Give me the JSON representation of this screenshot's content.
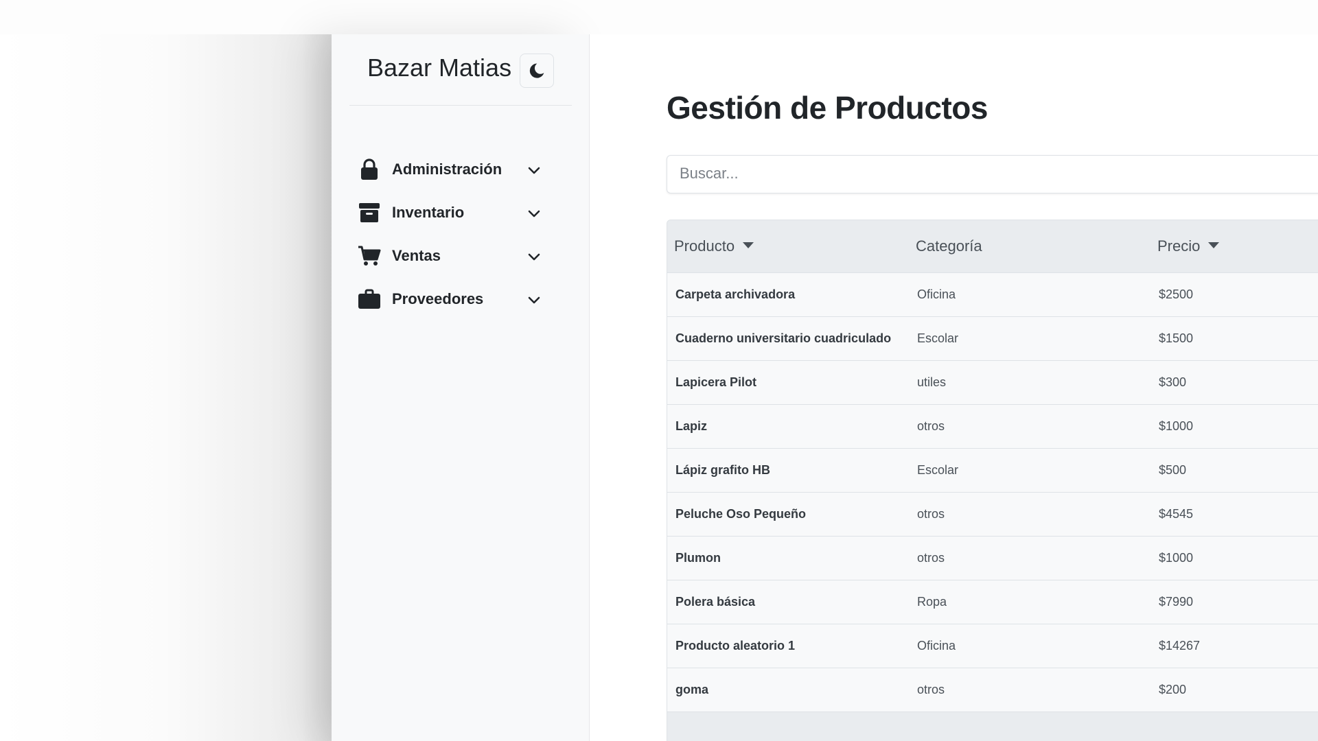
{
  "sidebar": {
    "brand": "Bazar Matias",
    "theme_toggle_icon": "moon-icon",
    "items": [
      {
        "label": "Administración",
        "icon": "lock-icon"
      },
      {
        "label": "Inventario",
        "icon": "archive-icon"
      },
      {
        "label": "Ventas",
        "icon": "cart-icon"
      },
      {
        "label": "Proveedores",
        "icon": "briefcase-icon"
      }
    ]
  },
  "main": {
    "title": "Gestión de Productos",
    "search": {
      "placeholder": "Buscar...",
      "value": ""
    },
    "table": {
      "columns": [
        {
          "label": "Producto",
          "sortable": true
        },
        {
          "label": "Categoría",
          "sortable": false
        },
        {
          "label": "Precio",
          "sortable": true
        }
      ],
      "rows": [
        {
          "product": "Carpeta archivadora",
          "category": "Oficina",
          "price": "$2500"
        },
        {
          "product": "Cuaderno universitario cuadriculado",
          "category": "Escolar",
          "price": "$1500"
        },
        {
          "product": "Lapicera Pilot",
          "category": "utiles",
          "price": "$300"
        },
        {
          "product": "Lapiz",
          "category": "otros",
          "price": "$1000"
        },
        {
          "product": "Lápiz grafito HB",
          "category": "Escolar",
          "price": "$500"
        },
        {
          "product": "Peluche Oso Pequeño",
          "category": "otros",
          "price": "$4545"
        },
        {
          "product": "Plumon",
          "category": "otros",
          "price": "$1000"
        },
        {
          "product": "Polera básica",
          "category": "Ropa",
          "price": "$7990"
        },
        {
          "product": "Producto aleatorio 1",
          "category": "Oficina",
          "price": "$14267"
        },
        {
          "product": "goma",
          "category": "otros",
          "price": "$200"
        }
      ]
    }
  },
  "colors": {
    "sidebar_bg": "#f8f9fa",
    "table_header_bg": "#e9ecef",
    "text": "#212529"
  }
}
